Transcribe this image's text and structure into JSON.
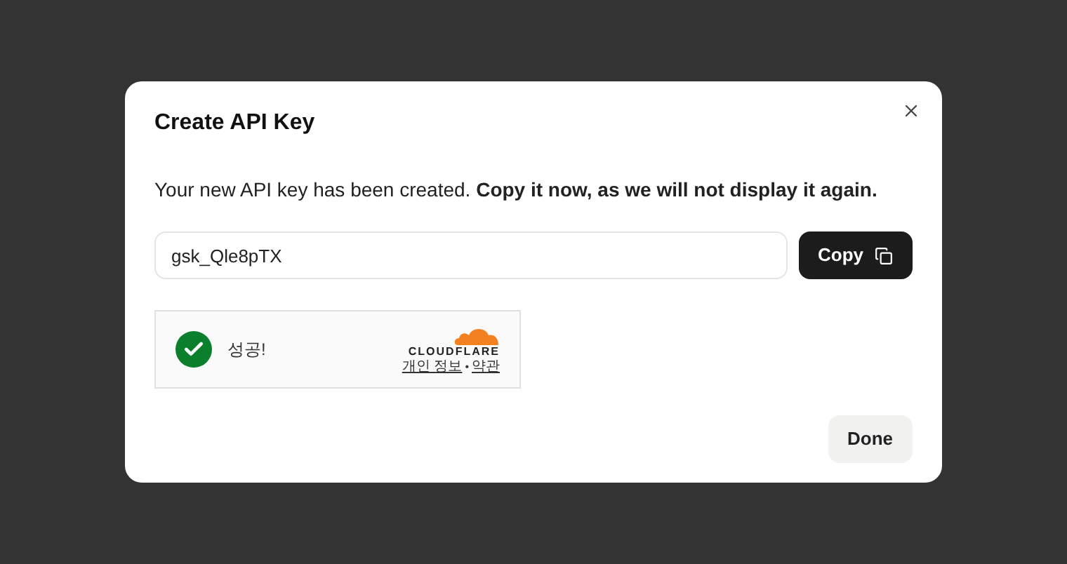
{
  "dialog": {
    "title": "Create API Key",
    "message": "Your new API key has been created. **Copy it now, as we will not display it again.**"
  },
  "key_field": {
    "value": "gsk_Qle8pTX"
  },
  "copy_button": {
    "label": "Copy"
  },
  "captcha": {
    "status": "성공!",
    "success": true,
    "brand": "CLOUDFLARE",
    "links": [
      "개인 정보",
      "약관"
    ],
    "separator": "•"
  },
  "buttons": [
    "Done"
  ]
}
